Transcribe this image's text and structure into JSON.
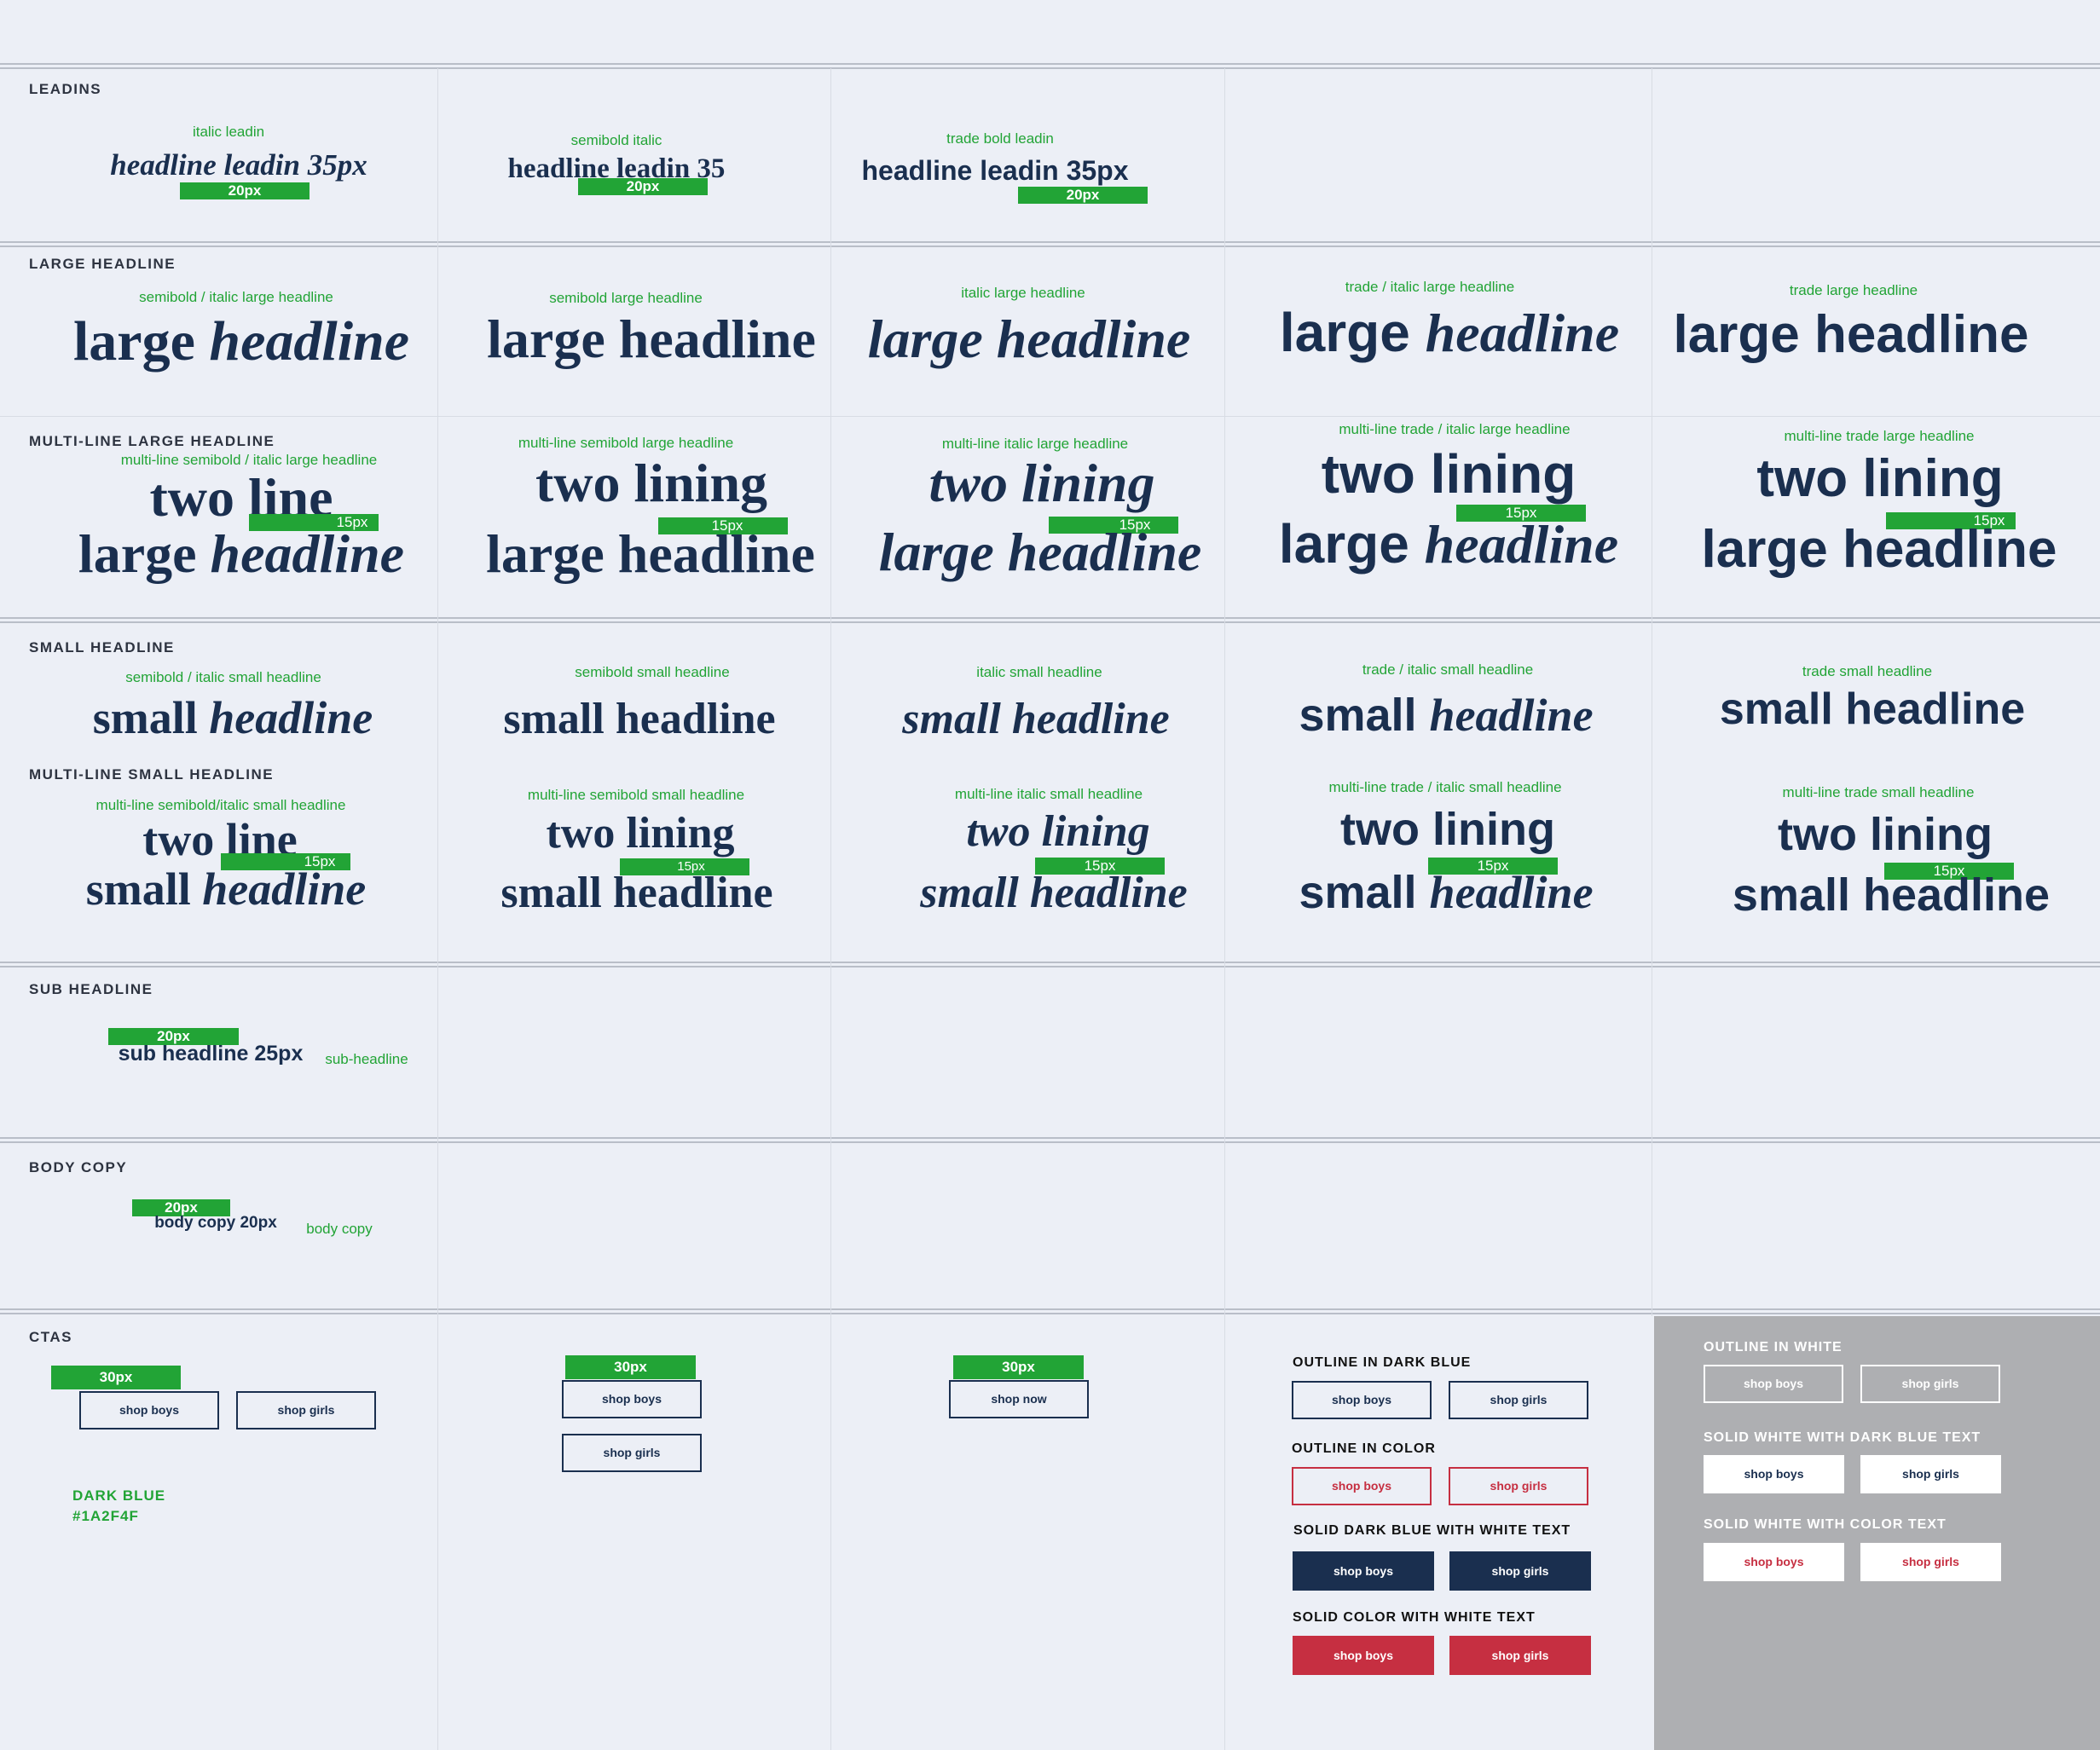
{
  "colors": {
    "background": "#eceff6",
    "navy": "#1a2f4f",
    "green": "#22a436",
    "red": "#c62f41",
    "gray_panel": "#aeafb2"
  },
  "leadins": {
    "section": "LEADINS",
    "items": [
      {
        "note": "italic leadin",
        "text": "headline leadin 35px",
        "bar": "20px"
      },
      {
        "note": "semibold italic",
        "text": "headline leadin 35",
        "bar": "20px"
      },
      {
        "note": "trade bold leadin",
        "text": "headline leadin 35px",
        "bar": "20px"
      }
    ]
  },
  "large_headline": {
    "section": "LARGE HEADLINE",
    "items": [
      {
        "note": "semibold / italic large headline",
        "a": "large",
        "b": "headline"
      },
      {
        "note": "semibold large headline",
        "text": "large headline"
      },
      {
        "note": "italic large headline",
        "text": "large headline"
      },
      {
        "note": "trade / italic large headline",
        "a": "large",
        "b": "headline"
      },
      {
        "note": "trade large headline",
        "text": "large headline"
      }
    ]
  },
  "multi_large": {
    "section": "MULTI-LINE LARGE HEADLINE",
    "items": [
      {
        "note": "multi-line semibold / italic large headline",
        "l1": "two line",
        "l2a": "large",
        "l2b": "headline",
        "bar": "15px"
      },
      {
        "note": "multi-line semibold large headline",
        "l1": "two lining",
        "l2": "large headline",
        "bar": "15px"
      },
      {
        "note": "multi-line italic large headline",
        "l1": "two lining",
        "l2": "large headline",
        "bar": "15px"
      },
      {
        "note": "multi-line trade / italic large headline",
        "l1": "two lining",
        "l2a": "large",
        "l2b": "headline",
        "bar": "15px"
      },
      {
        "note": "multi-line trade large headline",
        "l1": "two lining",
        "l2": "large headline",
        "bar": "15px"
      }
    ]
  },
  "small_headline": {
    "section": "SMALL HEADLINE",
    "items": [
      {
        "note": "semibold / italic small headline",
        "a": "small",
        "b": "headline"
      },
      {
        "note": "semibold small headline",
        "text": "small headline"
      },
      {
        "note": "italic small headline",
        "text": "small headline"
      },
      {
        "note": "trade / italic small headline",
        "a": "small",
        "b": "headline"
      },
      {
        "note": "trade small headline",
        "text": "small headline"
      }
    ]
  },
  "multi_small": {
    "section": "MULTI-LINE SMALL HEADLINE",
    "items": [
      {
        "note": "multi-line semibold/italic small headline",
        "l1": "two line",
        "l2a": "small",
        "l2b": "headline",
        "bar": "15px"
      },
      {
        "note": "multi-line semibold small headline",
        "l1": "two lining",
        "l2": "small headline",
        "bar": "15px"
      },
      {
        "note": "multi-line italic small headline",
        "l1": "two lining",
        "l2": "small headline",
        "bar": "15px"
      },
      {
        "note": "multi-line trade / italic small headline",
        "l1": "two lining",
        "l2a": "small",
        "l2b": "headline",
        "bar": "15px"
      },
      {
        "note": "multi-line trade small headline",
        "l1": "two lining",
        "l2": "small headline",
        "bar": "15px"
      }
    ]
  },
  "sub_headline": {
    "section": "SUB HEADLINE",
    "bar": "20px",
    "text": "sub headline 25px",
    "note": "sub-headline"
  },
  "body_copy": {
    "section": "BODY COPY",
    "bar": "20px",
    "text": "body copy 20px",
    "note": "body copy"
  },
  "ctas": {
    "section": "CTAS",
    "bar": "30px",
    "shop_boys": "shop boys",
    "shop_girls": "shop girls",
    "shop_now": "shop now",
    "color_name": "DARK BLUE",
    "color_hex": "#1A2F4F",
    "outline_dark_blue": "OUTLINE IN DARK BLUE",
    "outline_color": "OUTLINE IN COLOR",
    "solid_dark_blue": "SOLID DARK BLUE WITH WHITE TEXT",
    "solid_color": "SOLID COLOR WITH WHITE TEXT",
    "outline_white": "OUTLINE IN WHITE",
    "solid_white_blue": "SOLID WHITE WITH DARK BLUE TEXT",
    "solid_white_color": "SOLID WHITE WITH COLOR TEXT"
  }
}
